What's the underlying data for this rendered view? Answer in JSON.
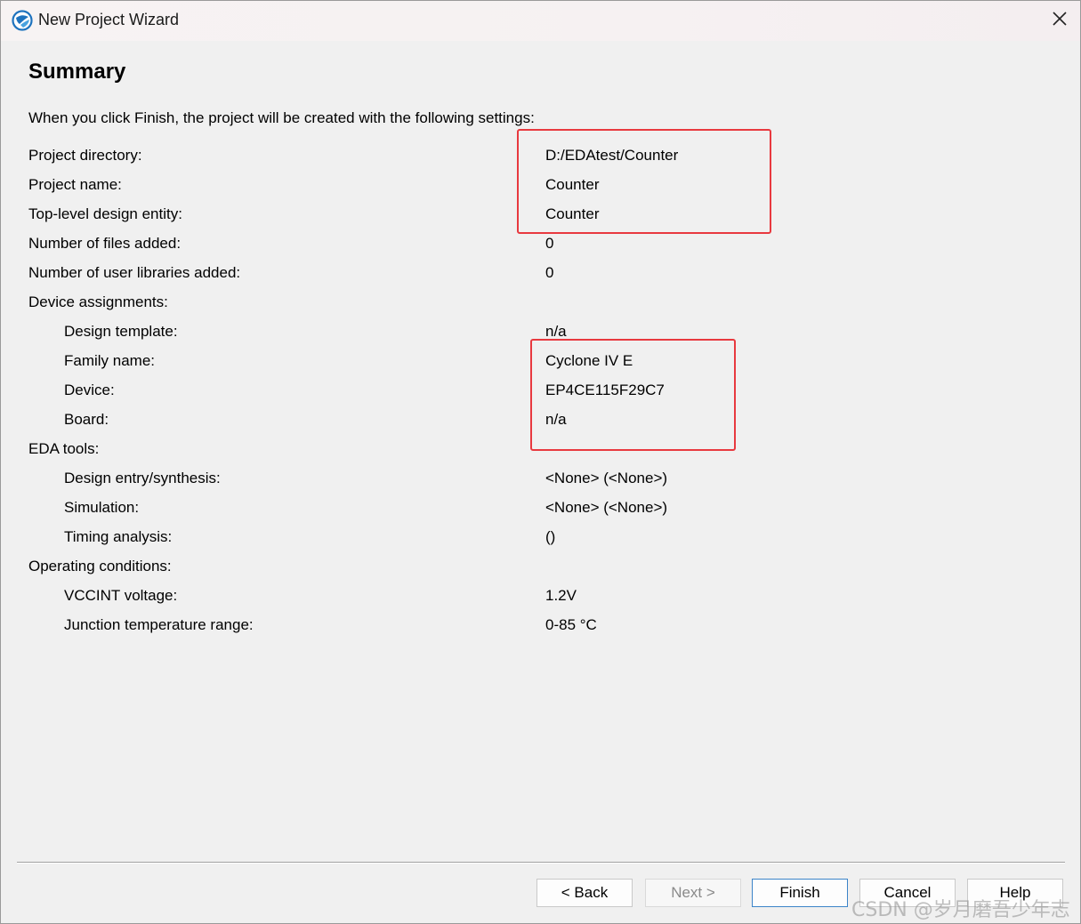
{
  "window": {
    "title": "New Project Wizard"
  },
  "page": {
    "heading": "Summary",
    "intro": "When you click Finish, the project will be created with the following settings:"
  },
  "settings": [
    {
      "label": "Project directory:",
      "value": "D:/EDAtest/Counter",
      "indent": false
    },
    {
      "label": "Project name:",
      "value": "Counter",
      "indent": false
    },
    {
      "label": "Top-level design entity:",
      "value": "Counter",
      "indent": false
    },
    {
      "label": "Number of files added:",
      "value": "0",
      "indent": false
    },
    {
      "label": "Number of user libraries added:",
      "value": "0",
      "indent": false
    },
    {
      "label": "Device assignments:",
      "value": "",
      "indent": false
    },
    {
      "label": "Design template:",
      "value": "n/a",
      "indent": true
    },
    {
      "label": "Family name:",
      "value": "Cyclone IV E",
      "indent": true
    },
    {
      "label": "Device:",
      "value": "EP4CE115F29C7",
      "indent": true
    },
    {
      "label": "Board:",
      "value": "n/a",
      "indent": true
    },
    {
      "label": "EDA tools:",
      "value": "",
      "indent": false
    },
    {
      "label": "Design entry/synthesis:",
      "value": "<None> (<None>)",
      "indent": true
    },
    {
      "label": "Simulation:",
      "value": "<None> (<None>)",
      "indent": true
    },
    {
      "label": "Timing analysis:",
      "value": " ()",
      "indent": true
    },
    {
      "label": "Operating conditions:",
      "value": "",
      "indent": false
    },
    {
      "label": "VCCINT voltage:",
      "value": "1.2V",
      "indent": true
    },
    {
      "label": "Junction temperature range:",
      "value": "0-85 °C",
      "indent": true
    }
  ],
  "buttons": {
    "back": "< Back",
    "next": "Next >",
    "finish": "Finish",
    "cancel": "Cancel",
    "help": "Help"
  },
  "watermark": "CSDN @岁月磨吾少年志",
  "colors": {
    "highlight": "#e8393f",
    "default_button_border": "#3c84c8"
  },
  "icons": {
    "app": "quartus-globe-icon",
    "close": "close-icon"
  }
}
